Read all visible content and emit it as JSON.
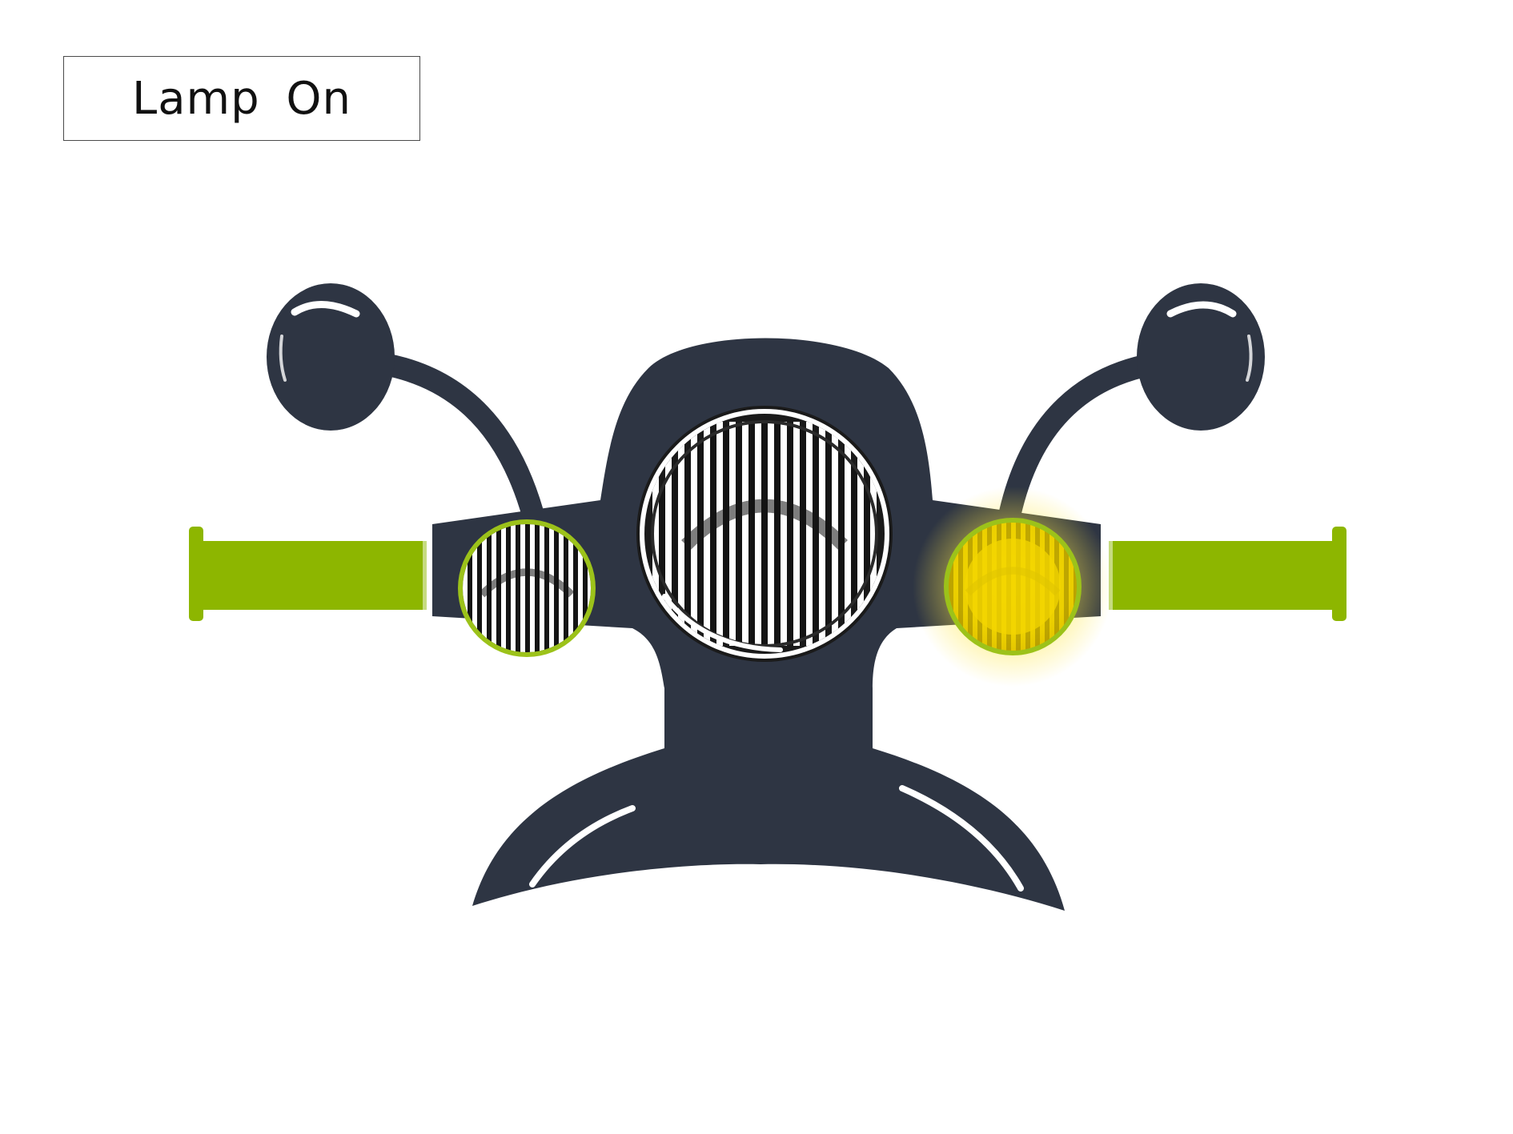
{
  "status_label": "Lamp On",
  "colors": {
    "body": "#2e3543",
    "grip": "#8db600",
    "bezel": "#9cc21a",
    "lamp_on": "#f2d600",
    "lamp_glow": "#ffe84a",
    "lens_dark": "#141414",
    "highlight": "#ffffff"
  },
  "icons": {
    "headlight": "headlight-icon",
    "left_indicator": "left-indicator-icon",
    "right_indicator": "right-indicator-icon",
    "left_mirror": "left-mirror-icon",
    "right_mirror": "right-mirror-icon",
    "left_grip": "left-grip-icon",
    "right_grip": "right-grip-icon"
  },
  "indicators": {
    "left": {
      "state": "off"
    },
    "right": {
      "state": "on"
    }
  }
}
